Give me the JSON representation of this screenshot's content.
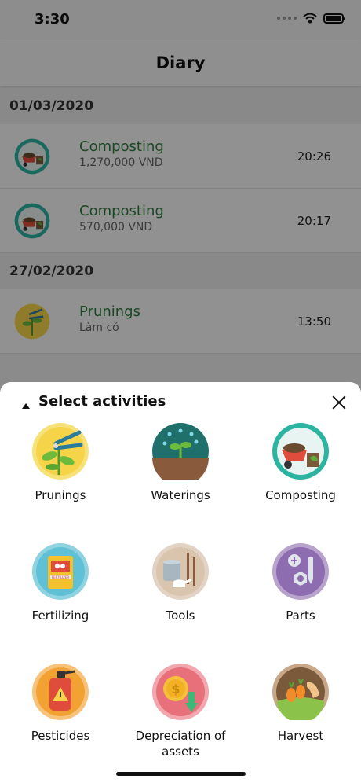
{
  "status_bar": {
    "time": "3:30"
  },
  "header": {
    "title": "Diary"
  },
  "diary": {
    "groups": [
      {
        "date": "01/03/2020",
        "entries": [
          {
            "name": "Composting",
            "sub": "1,270,000 VND",
            "time": "20:26",
            "icon": "composting-icon"
          },
          {
            "name": "Composting",
            "sub": "570,000 VND",
            "time": "20:17",
            "icon": "composting-icon"
          }
        ]
      },
      {
        "date": "27/02/2020",
        "entries": [
          {
            "name": "Prunings",
            "sub": "Làm cỏ",
            "time": "13:50",
            "icon": "prunings-icon"
          }
        ]
      }
    ]
  },
  "sheet": {
    "title": "Select activities",
    "activities": [
      {
        "label": "Prunings",
        "icon": "prunings-icon"
      },
      {
        "label": "Waterings",
        "icon": "waterings-icon"
      },
      {
        "label": "Composting",
        "icon": "composting-icon"
      },
      {
        "label": "Fertilizing",
        "icon": "fertilizing-icon"
      },
      {
        "label": "Tools",
        "icon": "tools-icon"
      },
      {
        "label": "Parts",
        "icon": "parts-icon"
      },
      {
        "label": "Pesticides",
        "icon": "pesticides-icon"
      },
      {
        "label": "Depreciation of assets",
        "icon": "depreciation-icon"
      },
      {
        "label": "Harvest",
        "icon": "harvest-icon"
      }
    ],
    "fertilizer_bag_text": "FERTILIZER"
  },
  "colors": {
    "entry_name": "#2e7a3c",
    "composting_ring": "#2bb4a0",
    "prunings_bg": "#f5d44a",
    "waterings_bg": "#1f6f6a",
    "parts_bg": "#8e6cb0",
    "pesticides_bg": "#f2a233",
    "depreciation_bg": "#e8707a",
    "harvest_bg": "#7a5a3a"
  }
}
